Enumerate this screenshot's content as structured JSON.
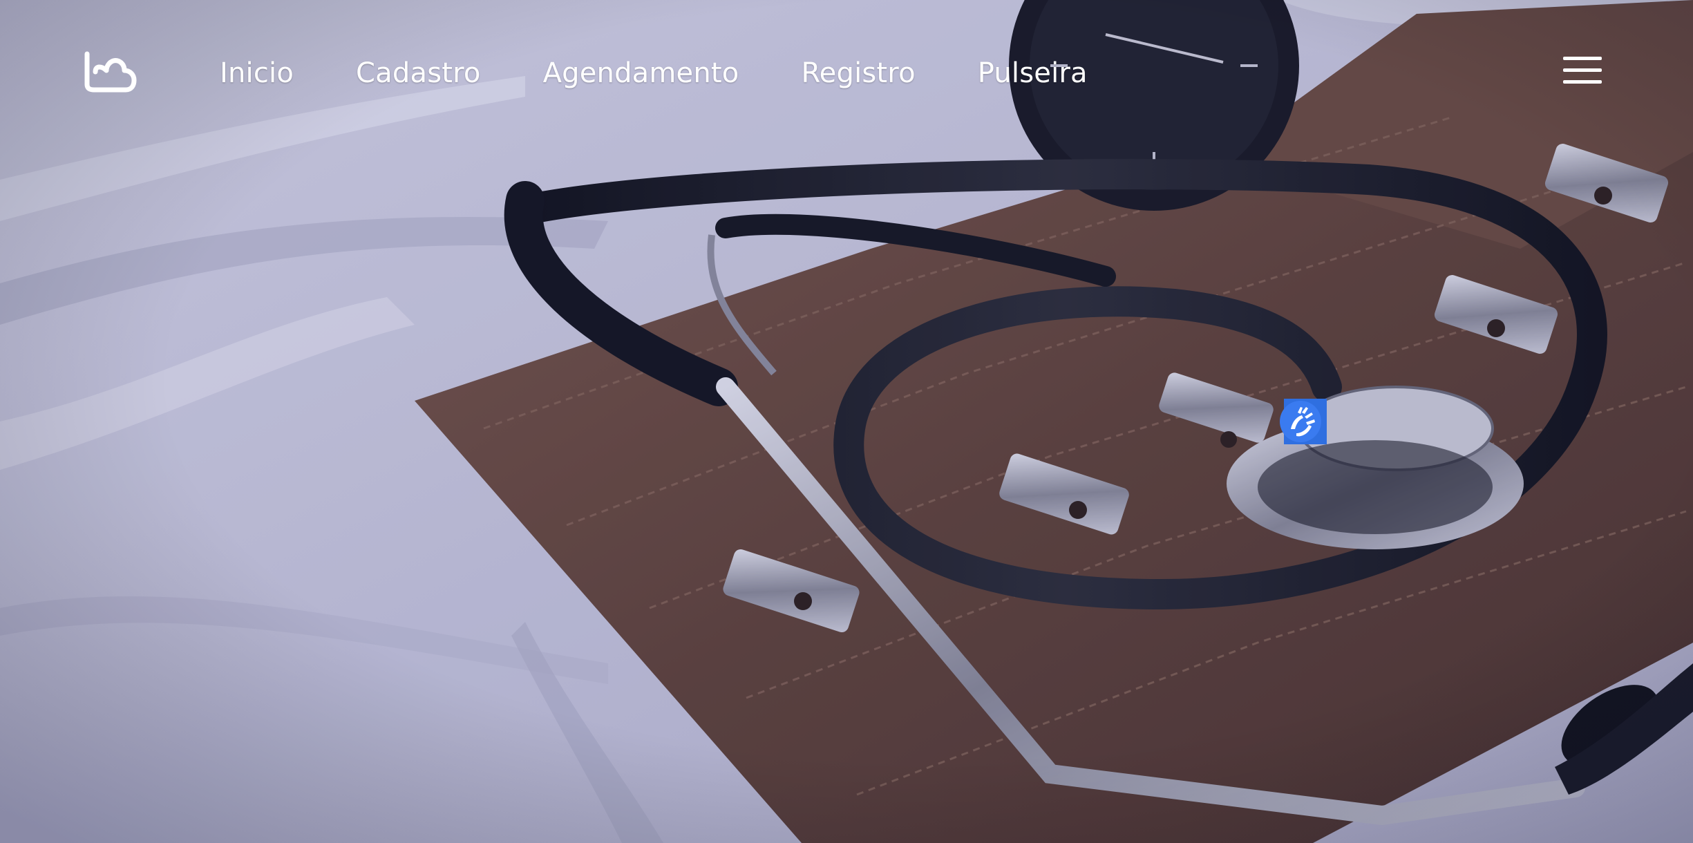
{
  "header": {
    "logo_icon": "heart-outline-logo",
    "nav": [
      {
        "label": "Inicio"
      },
      {
        "label": "Cadastro"
      },
      {
        "label": "Agendamento"
      },
      {
        "label": "Registro"
      },
      {
        "label": "Pulseira"
      }
    ],
    "menu_icon": "hamburger-menu-icon"
  },
  "hero": {
    "image_subject": "stethoscope-and-blood-pressure-cuff-photo",
    "overlay_color": "#3b3f8f"
  },
  "accessibility": {
    "icon": "sign-language-hands-icon",
    "accent": "#2f6fe0"
  },
  "colors": {
    "nav_text": "#ffffff",
    "cuff": "#6b4a36",
    "sheet": "#e7e6ef"
  }
}
